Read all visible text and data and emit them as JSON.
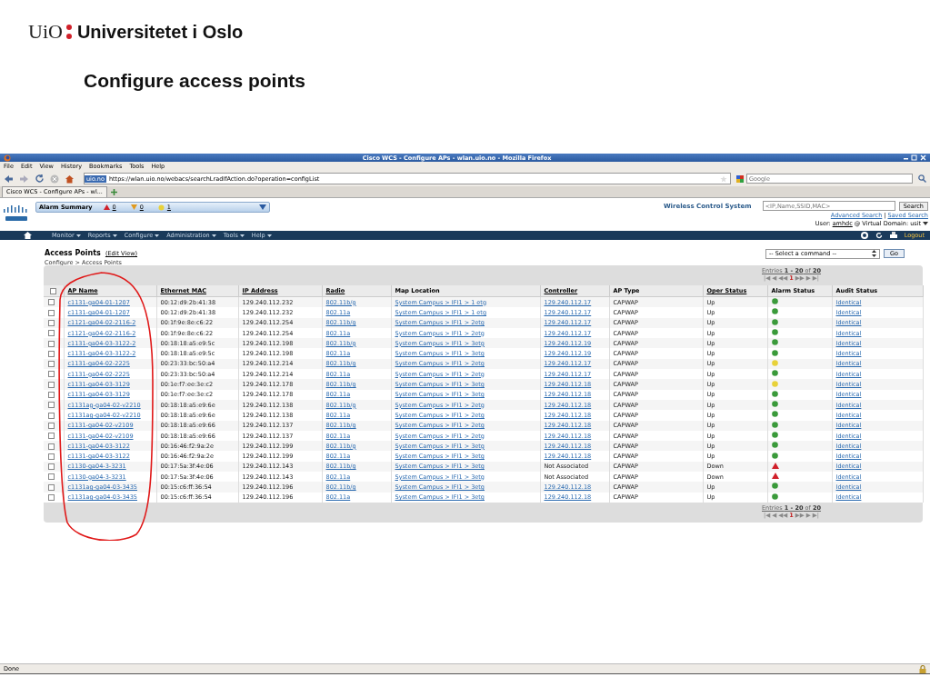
{
  "slide": {
    "logo_short": "UiO",
    "logo_long": "Universitetet i Oslo",
    "title": "Configure access points"
  },
  "window": {
    "title": "Cisco WCS - Configure APs - wlan.uio.no - Mozilla Firefox"
  },
  "menu": [
    "File",
    "Edit",
    "View",
    "History",
    "Bookmarks",
    "Tools",
    "Help"
  ],
  "toolbar": {
    "site_badge": "uio.no",
    "url": "https://wlan.uio.no/webacs/searchLradIfAction.do?operation=configList",
    "search_placeholder": "Google"
  },
  "tabs": [
    {
      "label": "Cisco WCS - Configure APs - wl...",
      "selected": true
    }
  ],
  "header": {
    "alarm_summary": "Alarm Summary",
    "alarms": [
      {
        "kind": "critical",
        "count": "0"
      },
      {
        "kind": "major",
        "count": "0"
      },
      {
        "kind": "minor",
        "count": "1"
      }
    ],
    "product": "Wireless Control System",
    "search_placeholder": "<IP,Name,SSID,MAC>",
    "search_button": "Search",
    "advanced_search": "Advanced Search",
    "separator": "|",
    "saved_search": "Saved Search",
    "user_label": "User:",
    "user": "amhdc",
    "domain": "@ Virtual Domain: usit"
  },
  "nav": {
    "items": [
      "Monitor",
      "Reports",
      "Configure",
      "Administration",
      "Tools",
      "Help"
    ],
    "logout": "Logout"
  },
  "page": {
    "title": "Access Points",
    "edit_view": "(Edit View)",
    "breadcrumb": "Configure > Access Points",
    "command_placeholder": "-- Select a command --",
    "go": "Go",
    "entries_top": {
      "prefix": "Entries",
      "range": "1 - 20",
      "of": "of",
      "total": "20"
    },
    "entries_bottom": {
      "prefix": "Entries",
      "range": "1 - 20",
      "of": "of",
      "total": "20"
    },
    "pagination_top": [
      {
        "label": "|◀",
        "selected": false
      },
      {
        "label": "◀",
        "selected": false
      },
      {
        "label": "◀◀",
        "selected": false
      },
      {
        "label": "1",
        "selected": true
      },
      {
        "label": "▶▶",
        "selected": false
      },
      {
        "label": "▶",
        "selected": false
      },
      {
        "label": "▶|",
        "selected": false
      }
    ],
    "pagination_bottom": [
      {
        "label": "|◀",
        "selected": false
      },
      {
        "label": "◀",
        "selected": false
      },
      {
        "label": "◀◀",
        "selected": false
      },
      {
        "label": "1",
        "selected": true
      },
      {
        "label": "▶▶",
        "selected": false
      },
      {
        "label": "▶",
        "selected": false
      },
      {
        "label": "▶|",
        "selected": false
      }
    ]
  },
  "table": {
    "select_all": {
      "checked": false
    },
    "columns": [
      {
        "label": "AP Name",
        "sortable": true
      },
      {
        "label": "Ethernet MAC",
        "sortable": true
      },
      {
        "label": "IP Address",
        "sortable": true
      },
      {
        "label": "Radio",
        "sortable": true
      },
      {
        "label": "Map Location",
        "sortable": false
      },
      {
        "label": "Controller",
        "sortable": true
      },
      {
        "label": "AP Type",
        "sortable": false
      },
      {
        "label": "Oper Status",
        "sortable": true
      },
      {
        "label": "Alarm Status",
        "sortable": false
      },
      {
        "label": "Audit Status",
        "sortable": false
      }
    ],
    "rows": [
      {
        "checked": false,
        "ap_name": "c1131-ga04-01-1207",
        "mac": "00:12:d9:2b:41:38",
        "ip": "129.240.112.232",
        "radio": "802.11b/g",
        "map": "System Campus > IFI1 > 1 etg",
        "controller": "129.240.112.17",
        "controller_linked": true,
        "ap_type": "CAPWAP",
        "oper": "Up",
        "alarm": {
          "kind": "dot",
          "color": "#3a9a3a"
        },
        "audit": "Identical"
      },
      {
        "checked": false,
        "ap_name": "c1131-ga04-01-1207",
        "mac": "00:12:d9:2b:41:38",
        "ip": "129.240.112.232",
        "radio": "802.11a",
        "map": "System Campus > IFI1 > 1 etg",
        "controller": "129.240.112.17",
        "controller_linked": true,
        "ap_type": "CAPWAP",
        "oper": "Up",
        "alarm": {
          "kind": "dot",
          "color": "#3a9a3a"
        },
        "audit": "Identical"
      },
      {
        "checked": false,
        "ap_name": "c1121-ga04-02-2116-2",
        "mac": "00:1f:9e:8e:c6:22",
        "ip": "129.240.112.254",
        "radio": "802.11b/g",
        "map": "System Campus > IFI1 > 2etg",
        "controller": "129.240.112.17",
        "controller_linked": true,
        "ap_type": "CAPWAP",
        "oper": "Up",
        "alarm": {
          "kind": "dot",
          "color": "#3a9a3a"
        },
        "audit": "Identical"
      },
      {
        "checked": false,
        "ap_name": "c1121-ga04-02-2116-2",
        "mac": "00:1f:9e:8e:c6:22",
        "ip": "129.240.112.254",
        "radio": "802.11a",
        "map": "System Campus > IFI1 > 2etg",
        "controller": "129.240.112.17",
        "controller_linked": true,
        "ap_type": "CAPWAP",
        "oper": "Up",
        "alarm": {
          "kind": "dot",
          "color": "#3a9a3a"
        },
        "audit": "Identical"
      },
      {
        "checked": false,
        "ap_name": "c1131-ga04-03-3122-2",
        "mac": "00:18:18:a5:e9:5c",
        "ip": "129.240.112.198",
        "radio": "802.11b/g",
        "map": "System Campus > IFI1 > 3etg",
        "controller": "129.240.112.19",
        "controller_linked": true,
        "ap_type": "CAPWAP",
        "oper": "Up",
        "alarm": {
          "kind": "dot",
          "color": "#3a9a3a"
        },
        "audit": "Identical"
      },
      {
        "checked": false,
        "ap_name": "c1131-ga04-03-3122-2",
        "mac": "00:18:18:a5:e9:5c",
        "ip": "129.240.112.198",
        "radio": "802.11a",
        "map": "System Campus > IFI1 > 3etg",
        "controller": "129.240.112.19",
        "controller_linked": true,
        "ap_type": "CAPWAP",
        "oper": "Up",
        "alarm": {
          "kind": "dot",
          "color": "#3a9a3a"
        },
        "audit": "Identical"
      },
      {
        "checked": false,
        "ap_name": "c1131-ga04-02-2225",
        "mac": "00:23:33:bc:50:a4",
        "ip": "129.240.112.214",
        "radio": "802.11b/g",
        "map": "System Campus > IFI1 > 2etg",
        "controller": "129.240.112.17",
        "controller_linked": true,
        "ap_type": "CAPWAP",
        "oper": "Up",
        "alarm": {
          "kind": "dot",
          "color": "#e8d23a"
        },
        "audit": "Identical"
      },
      {
        "checked": false,
        "ap_name": "c1131-ga04-02-2225",
        "mac": "00:23:33:bc:50:a4",
        "ip": "129.240.112.214",
        "radio": "802.11a",
        "map": "System Campus > IFI1 > 2etg",
        "controller": "129.240.112.17",
        "controller_linked": true,
        "ap_type": "CAPWAP",
        "oper": "Up",
        "alarm": {
          "kind": "dot",
          "color": "#3a9a3a"
        },
        "audit": "Identical"
      },
      {
        "checked": false,
        "ap_name": "c1131-ga04-03-3129",
        "mac": "00:1e:f7:ee:3e:c2",
        "ip": "129.240.112.178",
        "radio": "802.11b/g",
        "map": "System Campus > IFI1 > 3etg",
        "controller": "129.240.112.18",
        "controller_linked": true,
        "ap_type": "CAPWAP",
        "oper": "Up",
        "alarm": {
          "kind": "dot",
          "color": "#e8d23a"
        },
        "audit": "Identical"
      },
      {
        "checked": false,
        "ap_name": "c1131-ga04-03-3129",
        "mac": "00:1e:f7:ee:3e:c2",
        "ip": "129.240.112.178",
        "radio": "802.11a",
        "map": "System Campus > IFI1 > 3etg",
        "controller": "129.240.112.18",
        "controller_linked": true,
        "ap_type": "CAPWAP",
        "oper": "Up",
        "alarm": {
          "kind": "dot",
          "color": "#3a9a3a"
        },
        "audit": "Identical"
      },
      {
        "checked": false,
        "ap_name": "c1131ag-ga04-02-v2210",
        "mac": "00:18:18:a5:e9:6e",
        "ip": "129.240.112.138",
        "radio": "802.11b/g",
        "map": "System Campus > IFI1 > 2etg",
        "controller": "129.240.112.18",
        "controller_linked": true,
        "ap_type": "CAPWAP",
        "oper": "Up",
        "alarm": {
          "kind": "dot",
          "color": "#3a9a3a"
        },
        "audit": "Identical"
      },
      {
        "checked": false,
        "ap_name": "c1131ag-ga04-02-v2210",
        "mac": "00:18:18:a5:e9:6e",
        "ip": "129.240.112.138",
        "radio": "802.11a",
        "map": "System Campus > IFI1 > 2etg",
        "controller": "129.240.112.18",
        "controller_linked": true,
        "ap_type": "CAPWAP",
        "oper": "Up",
        "alarm": {
          "kind": "dot",
          "color": "#3a9a3a"
        },
        "audit": "Identical"
      },
      {
        "checked": false,
        "ap_name": "c1131-ga04-02-v2109",
        "mac": "00:18:18:a5:e9:66",
        "ip": "129.240.112.137",
        "radio": "802.11b/g",
        "map": "System Campus > IFI1 > 2etg",
        "controller": "129.240.112.18",
        "controller_linked": true,
        "ap_type": "CAPWAP",
        "oper": "Up",
        "alarm": {
          "kind": "dot",
          "color": "#3a9a3a"
        },
        "audit": "Identical"
      },
      {
        "checked": false,
        "ap_name": "c1131-ga04-02-v2109",
        "mac": "00:18:18:a5:e9:66",
        "ip": "129.240.112.137",
        "radio": "802.11a",
        "map": "System Campus > IFI1 > 2etg",
        "controller": "129.240.112.18",
        "controller_linked": true,
        "ap_type": "CAPWAP",
        "oper": "Up",
        "alarm": {
          "kind": "dot",
          "color": "#3a9a3a"
        },
        "audit": "Identical"
      },
      {
        "checked": false,
        "ap_name": "c1131-ga04-03-3122",
        "mac": "00:16:46:f2:9a:2e",
        "ip": "129.240.112.199",
        "radio": "802.11b/g",
        "map": "System Campus > IFI1 > 3etg",
        "controller": "129.240.112.18",
        "controller_linked": true,
        "ap_type": "CAPWAP",
        "oper": "Up",
        "alarm": {
          "kind": "dot",
          "color": "#3a9a3a"
        },
        "audit": "Identical"
      },
      {
        "checked": false,
        "ap_name": "c1131-ga04-03-3122",
        "mac": "00:16:46:f2:9a:2e",
        "ip": "129.240.112.199",
        "radio": "802.11a",
        "map": "System Campus > IFI1 > 3etg",
        "controller": "129.240.112.18",
        "controller_linked": true,
        "ap_type": "CAPWAP",
        "oper": "Up",
        "alarm": {
          "kind": "dot",
          "color": "#3a9a3a"
        },
        "audit": "Identical"
      },
      {
        "checked": false,
        "ap_name": "c1130-ga04-3-3231",
        "mac": "00:17:5a:3f:4e:06",
        "ip": "129.240.112.143",
        "radio": "802.11b/g",
        "map": "System Campus > IFI1 > 3etg",
        "controller": "Not Associated",
        "controller_linked": false,
        "ap_type": "CAPWAP",
        "oper": "Down",
        "alarm": {
          "kind": "triangle",
          "color": "#d0202a"
        },
        "audit": "Identical"
      },
      {
        "checked": false,
        "ap_name": "c1130-ga04-3-3231",
        "mac": "00:17:5a:3f:4e:06",
        "ip": "129.240.112.143",
        "radio": "802.11a",
        "map": "System Campus > IFI1 > 3etg",
        "controller": "Not Associated",
        "controller_linked": false,
        "ap_type": "CAPWAP",
        "oper": "Down",
        "alarm": {
          "kind": "triangle",
          "color": "#d0202a"
        },
        "audit": "Identical"
      },
      {
        "checked": false,
        "ap_name": "c1131ag-ga04-03-3435",
        "mac": "00:15:c6:ff:36:54",
        "ip": "129.240.112.196",
        "radio": "802.11b/g",
        "map": "System Campus > IFI1 > 3etg",
        "controller": "129.240.112.18",
        "controller_linked": true,
        "ap_type": "CAPWAP",
        "oper": "Up",
        "alarm": {
          "kind": "dot",
          "color": "#3a9a3a"
        },
        "audit": "Identical"
      },
      {
        "checked": false,
        "ap_name": "c1131ag-ga04-03-3435",
        "mac": "00:15:c6:ff:36:54",
        "ip": "129.240.112.196",
        "radio": "802.11a",
        "map": "System Campus > IFI1 > 3etg",
        "controller": "129.240.112.18",
        "controller_linked": true,
        "ap_type": "CAPWAP",
        "oper": "Up",
        "alarm": {
          "kind": "dot",
          "color": "#3a9a3a"
        },
        "audit": "Identical"
      }
    ]
  },
  "status_bar": {
    "text": "Done"
  }
}
